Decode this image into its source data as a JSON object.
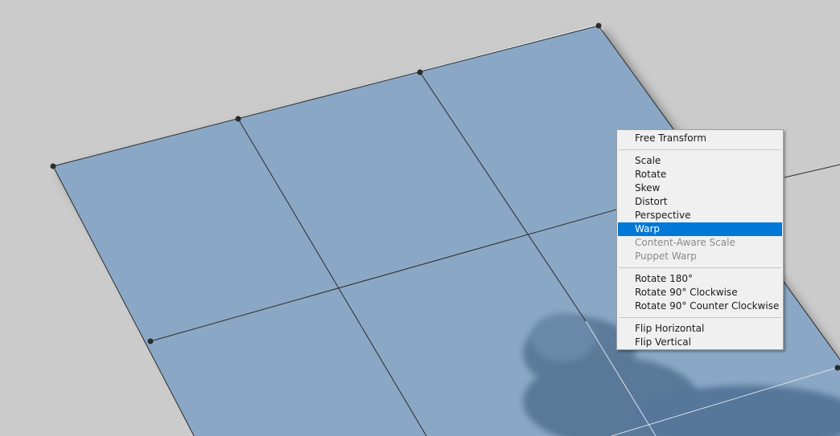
{
  "colors": {
    "background": "#cbcbcb",
    "layer_fill": "#8aa8c5",
    "grid_line": "#2b2b2b",
    "handle": "#2b2b2b",
    "menu_background": "#f0f0f0",
    "menu_highlight": "#0078d7",
    "disabled_text": "#8a8a8a"
  },
  "context_menu": {
    "free_transform": "Free Transform",
    "scale": "Scale",
    "rotate": "Rotate",
    "skew": "Skew",
    "distort": "Distort",
    "perspective": "Perspective",
    "warp": "Warp",
    "content_aware_scale": "Content-Aware Scale",
    "puppet_warp": "Puppet Warp",
    "rotate_180": "Rotate 180°",
    "rotate_90_cw": "Rotate 90° Clockwise",
    "rotate_90_ccw": "Rotate 90° Counter Clockwise",
    "flip_horizontal": "Flip Horizontal",
    "flip_vertical": "Flip Vertical",
    "selected_item": "Warp"
  }
}
